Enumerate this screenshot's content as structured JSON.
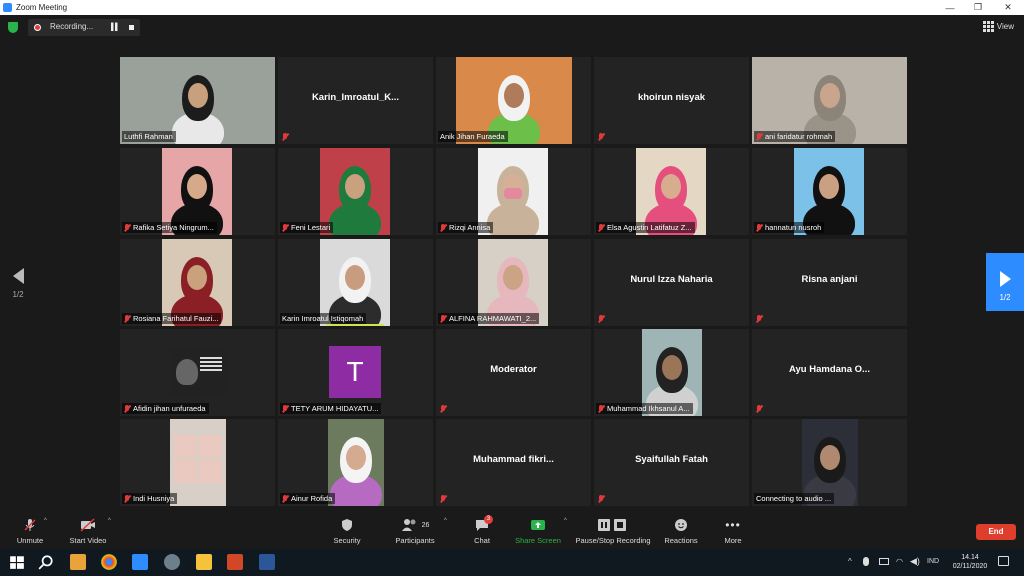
{
  "window": {
    "title": "Zoom Meeting",
    "controls": [
      "—",
      "❐",
      "✕"
    ]
  },
  "recording": {
    "label": "Recording..."
  },
  "view": {
    "label": "View"
  },
  "gallery": {
    "page_left": "1/2",
    "page_right": "1/2",
    "tiles": [
      {
        "name": "Luthfi Rahman",
        "label": "",
        "muted": false,
        "active": true,
        "kind": "video"
      },
      {
        "name": "",
        "label": "Karin_Imroatul_K...",
        "muted": true,
        "kind": "name"
      },
      {
        "name": "Anik Jihan Furaeda",
        "label": "",
        "muted": false,
        "kind": "video"
      },
      {
        "name": "",
        "label": "khoirun nisyak",
        "muted": true,
        "kind": "name"
      },
      {
        "name": "ani faridatur rohmah",
        "label": "",
        "muted": true,
        "kind": "video"
      },
      {
        "name": "Rafika Setiya Ningrum...",
        "label": "",
        "muted": true,
        "kind": "video"
      },
      {
        "name": "Feni Lestari",
        "label": "",
        "muted": true,
        "kind": "video"
      },
      {
        "name": "Rizqi Annisa",
        "label": "",
        "muted": true,
        "kind": "video"
      },
      {
        "name": "Elsa Agustin Latifatuz Z...",
        "label": "",
        "muted": true,
        "kind": "video"
      },
      {
        "name": "hannatun nusroh",
        "label": "",
        "muted": true,
        "kind": "video"
      },
      {
        "name": "Rosiana Farihatul Fauzi...",
        "label": "",
        "muted": true,
        "kind": "video"
      },
      {
        "name": "Karin Imroatul Istiqomah",
        "label": "",
        "muted": false,
        "kind": "video"
      },
      {
        "name": "ALFINA RAHMAWATI_2...",
        "label": "",
        "muted": true,
        "kind": "video"
      },
      {
        "name": "",
        "label": "Nurul Izza Naharia",
        "muted": true,
        "kind": "name"
      },
      {
        "name": "",
        "label": "Risna anjani",
        "muted": true,
        "kind": "name"
      },
      {
        "name": "Afidin jihan unfuraeda",
        "label": "",
        "muted": true,
        "kind": "video"
      },
      {
        "name": "TETY ARUM HIDAYATU...",
        "label": "",
        "muted": true,
        "kind": "avatar",
        "initial": "T"
      },
      {
        "name": "",
        "label": "Moderator",
        "muted": true,
        "kind": "name"
      },
      {
        "name": "Muhammad Ikhsanul A...",
        "label": "",
        "muted": true,
        "kind": "video"
      },
      {
        "name": "",
        "label": "Ayu Hamdana O...",
        "muted": true,
        "kind": "name"
      },
      {
        "name": "Indi Husniya",
        "label": "",
        "muted": true,
        "kind": "video"
      },
      {
        "name": "Ainur Rofida",
        "label": "",
        "muted": true,
        "kind": "video"
      },
      {
        "name": "",
        "label": "Muhammad  fikri...",
        "muted": true,
        "kind": "name"
      },
      {
        "name": "",
        "label": "Syaifullah Fatah",
        "muted": true,
        "kind": "name"
      },
      {
        "name": "Connecting to audio ...",
        "label": "",
        "muted": false,
        "kind": "video"
      }
    ]
  },
  "toolbar": {
    "unmute": "Unmute",
    "start_video": "Start Video",
    "security": "Security",
    "participants": "Participants",
    "participants_count": "26",
    "chat": "Chat",
    "chat_badge": "3",
    "share_screen": "Share Screen",
    "recording": "Pause/Stop Recording",
    "reactions": "Reactions",
    "more": "More",
    "end": "End"
  },
  "taskbar": {
    "lang": "IND",
    "time": "14.14",
    "date": "02/11/2020"
  },
  "colors": {
    "accent_blue": "#2d8cff",
    "active_speaker": "#d4e157",
    "muted_red": "#e03a3a",
    "end_red": "#e03e2d",
    "share_green": "#2ab24b"
  }
}
